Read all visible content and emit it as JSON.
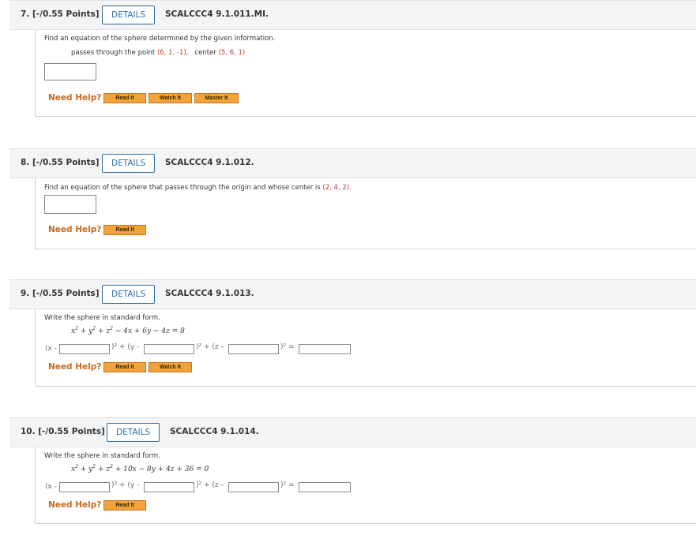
{
  "questions": [
    {
      "num_label": "7. [-/0.55 Points]",
      "details_label": "DETAILS",
      "code": "SCALCCC4 9.1.011.MI.",
      "prompt": "Find an equation of the sphere determined by the given information.",
      "line2_prefix": "passes through the point",
      "point": "(6, 1, -1),",
      "center_label": "center",
      "center": "(5, 6, 1)",
      "help_label": "Need Help?",
      "buttons": [
        "Read It",
        "Watch It",
        "Master It"
      ]
    },
    {
      "num_label": "8. [-/0.55 Points]",
      "details_label": "DETAILS",
      "code": "SCALCCC4 9.1.012.",
      "prompt": "Find an equation of the sphere that passes through the origin and whose center is",
      "center": "(2, 4, 2).",
      "help_label": "Need Help?",
      "buttons": [
        "Read It"
      ]
    },
    {
      "num_label": "9. [-/0.55 Points]",
      "details_label": "DETAILS",
      "code": "SCALCCC4 9.1.013.",
      "prompt": "Write the sphere in standard form.",
      "equation_rest": "− 4x + 6y − 4z = 8",
      "x_label": "(x -",
      "y_label": ")² + (y -",
      "z_label": ")² + (z -",
      "eq_label": ")² =",
      "help_label": "Need Help?",
      "buttons": [
        "Read It",
        "Watch It"
      ]
    },
    {
      "num_label": "10. [-/0.55 Points]",
      "details_label": "DETAILS",
      "code": "SCALCCC4 9.1.014.",
      "prompt": "Write the sphere in standard form.",
      "equation_rest": "+ 10x − 8y + 4z + 36 = 0",
      "x_label": "(x -",
      "y_label": ")² + (y -",
      "z_label": ")² + (z -",
      "eq_label": ")² =",
      "help_label": "Need Help?",
      "buttons": [
        "Read It"
      ]
    }
  ],
  "colors": {
    "details_blue": "#2e6da4",
    "help_orange": "#c9681d",
    "button_orange": "#f0a43a",
    "highlight_red": "#c0392b"
  }
}
